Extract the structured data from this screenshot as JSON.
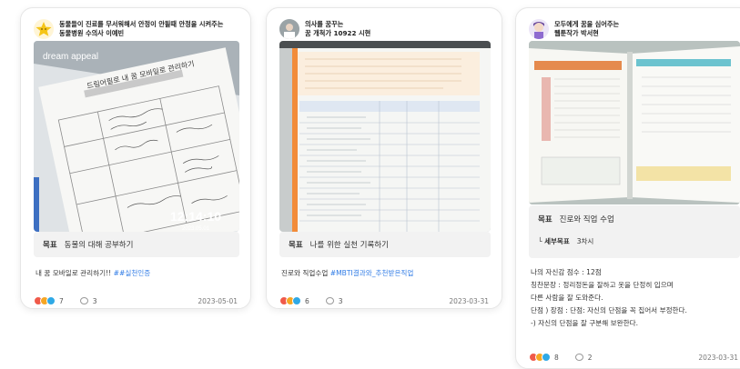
{
  "cards": [
    {
      "title_lines": [
        "동물들이 진료를 무서워해서 안정이 안될때 안정을 시켜주는",
        "동물병원 수의사 이예빈"
      ],
      "photo": {
        "brand": "dream appeal",
        "sheet_title": "드림어필로 내 꿈 모바일로 관리하기",
        "timestamp": "12:14:10",
        "timestamp_date": "2023.05.01"
      },
      "goal_label": "목표",
      "goal_value": "동물의 대해 공부하기",
      "body_plain": "내 꿈 모바일로 관리하기!! ",
      "body_tag": "##실천인증",
      "reactions_count": "7",
      "comments_count": "3",
      "date": "2023-05-01"
    },
    {
      "title_lines": [
        "의사를 꿈꾸는",
        "꿈 개척가 10922 시현"
      ],
      "goal_label": "목표",
      "goal_value": "나를 위한 실천 기록하기",
      "body_plain": "진로와 직업수업 ",
      "body_tag": "#MBTI결과와_추천받은직업",
      "reactions_count": "6",
      "comments_count": "3",
      "date": "2023-03-31"
    },
    {
      "title_lines": [
        "모두에게 꿈을 심어주는",
        "웹툰작가 박서현"
      ],
      "goal_label": "목표",
      "goal_value": "진로와 직업 수업",
      "sub_label": "└ 세부목표",
      "sub_value": "3차시",
      "body_lines": [
        "나의 자신감 점수 : 12점",
        "칭찬문장 : 정리정돈을 잘하고 옷을 단정히 입으며",
        "다른 사람을 잘 도와준다.",
        "단점 ) 장점 : 단점: 자신의 단점을 꼭 집어서 부정한다.",
        "-) 자신의 단점을 잘 구분해 보완한다."
      ],
      "reactions_count": "8",
      "comments_count": "2",
      "date": "2023-03-31"
    }
  ]
}
